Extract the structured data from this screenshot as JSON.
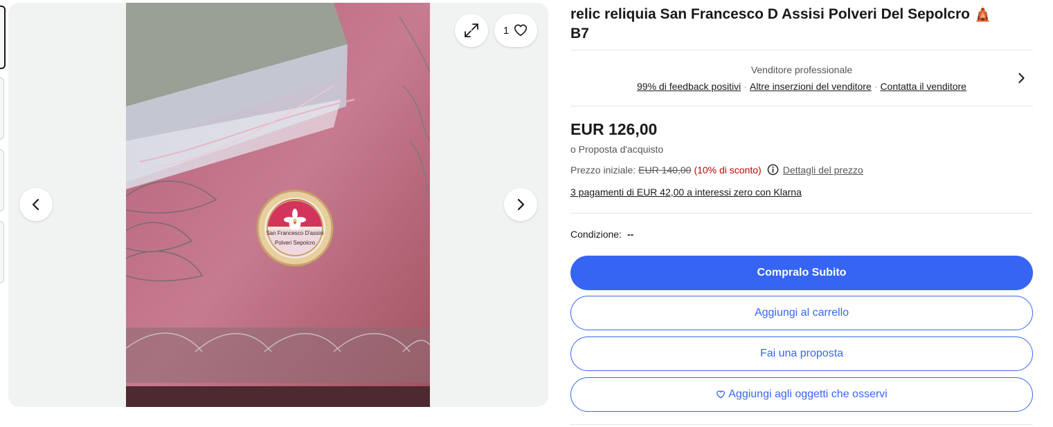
{
  "gallery": {
    "watch_count": "1",
    "image_alt_text": [
      "San Francesco D'assisi",
      "Polveri Sepolcro"
    ],
    "icons": {
      "prev": "chevron-left-icon",
      "next": "chevron-right-icon",
      "expand": "expand-icon",
      "watch": "heart-icon"
    }
  },
  "listing": {
    "title": "relic reliquia San Francesco D Assisi Polveri Del Sepolcro",
    "title_emoji": "🛕",
    "title_suffix": "B7"
  },
  "seller": {
    "type": "Venditore professionale",
    "feedback_link": "99% di feedback positivi",
    "other_listings_link": "Altre inserzioni del venditore",
    "contact_link": "Contatta il venditore",
    "separator": "·"
  },
  "pricing": {
    "price": "EUR 126,00",
    "offer_text": "o Proposta d'acquisto",
    "original_label": "Prezzo iniziale:",
    "original_price": "EUR 140,00",
    "discount": "(10% di sconto)",
    "details_link": "Dettagli del prezzo",
    "klarna_text": "3 pagamenti di EUR 42,00 a interessi zero con Klarna"
  },
  "condition": {
    "label": "Condizione:",
    "value": "--"
  },
  "actions": {
    "buy_now": "Compralo Subito",
    "add_to_cart": "Aggiungi al carrello",
    "make_offer": "Fai una proposta",
    "watch": "Aggiungi agli oggetti che osservi"
  },
  "colors": {
    "primary": "#3665f3",
    "discount": "#c20000",
    "text": "#191919",
    "muted": "#555555",
    "gallery_bg": "#f1f3f2"
  }
}
